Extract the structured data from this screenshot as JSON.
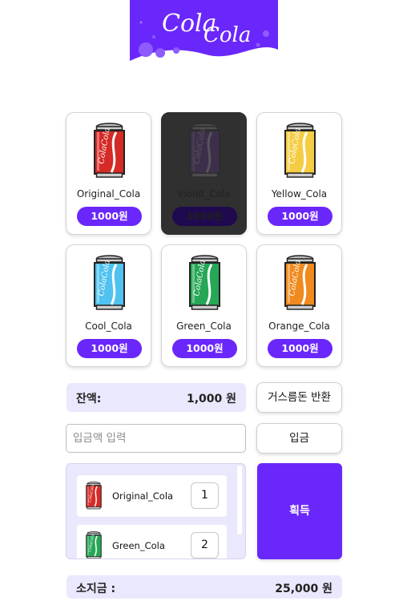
{
  "logo": {
    "text_1": "Cola",
    "text_2": "Cola",
    "background": "#6a27fb"
  },
  "products": [
    {
      "name": "Original_Cola",
      "price": "1000원",
      "color": "#d62a26",
      "soldout": false
    },
    {
      "name": "Violet_Cola",
      "price": "1000원",
      "color": "#7b2cc7",
      "soldout": true
    },
    {
      "name": "Yellow_Cola",
      "price": "1000원",
      "color": "#f5cd45",
      "soldout": false
    },
    {
      "name": "Cool_Cola",
      "price": "1000원",
      "color": "#4fc2f0",
      "soldout": false
    },
    {
      "name": "Green_Cola",
      "price": "1000원",
      "color": "#26a756",
      "soldout": false
    },
    {
      "name": "Orange_Cola",
      "price": "1000원",
      "color": "#f08a1e",
      "soldout": false
    }
  ],
  "balance": {
    "label": "잔액:",
    "value": "1,000 원"
  },
  "change_button": "거스름돈 반환",
  "deposit": {
    "placeholder": "입금액 입력",
    "button": "입금"
  },
  "cart": [
    {
      "name": "Original_Cola",
      "qty": "1",
      "color": "#d62a26"
    },
    {
      "name": "Green_Cola",
      "qty": "2",
      "color": "#26a756"
    }
  ],
  "get_button": "획득",
  "money": {
    "label": "소지금 :",
    "value": "25,000 원"
  },
  "colors": {
    "accent": "#6a27fb",
    "panel": "#eae8fd"
  }
}
